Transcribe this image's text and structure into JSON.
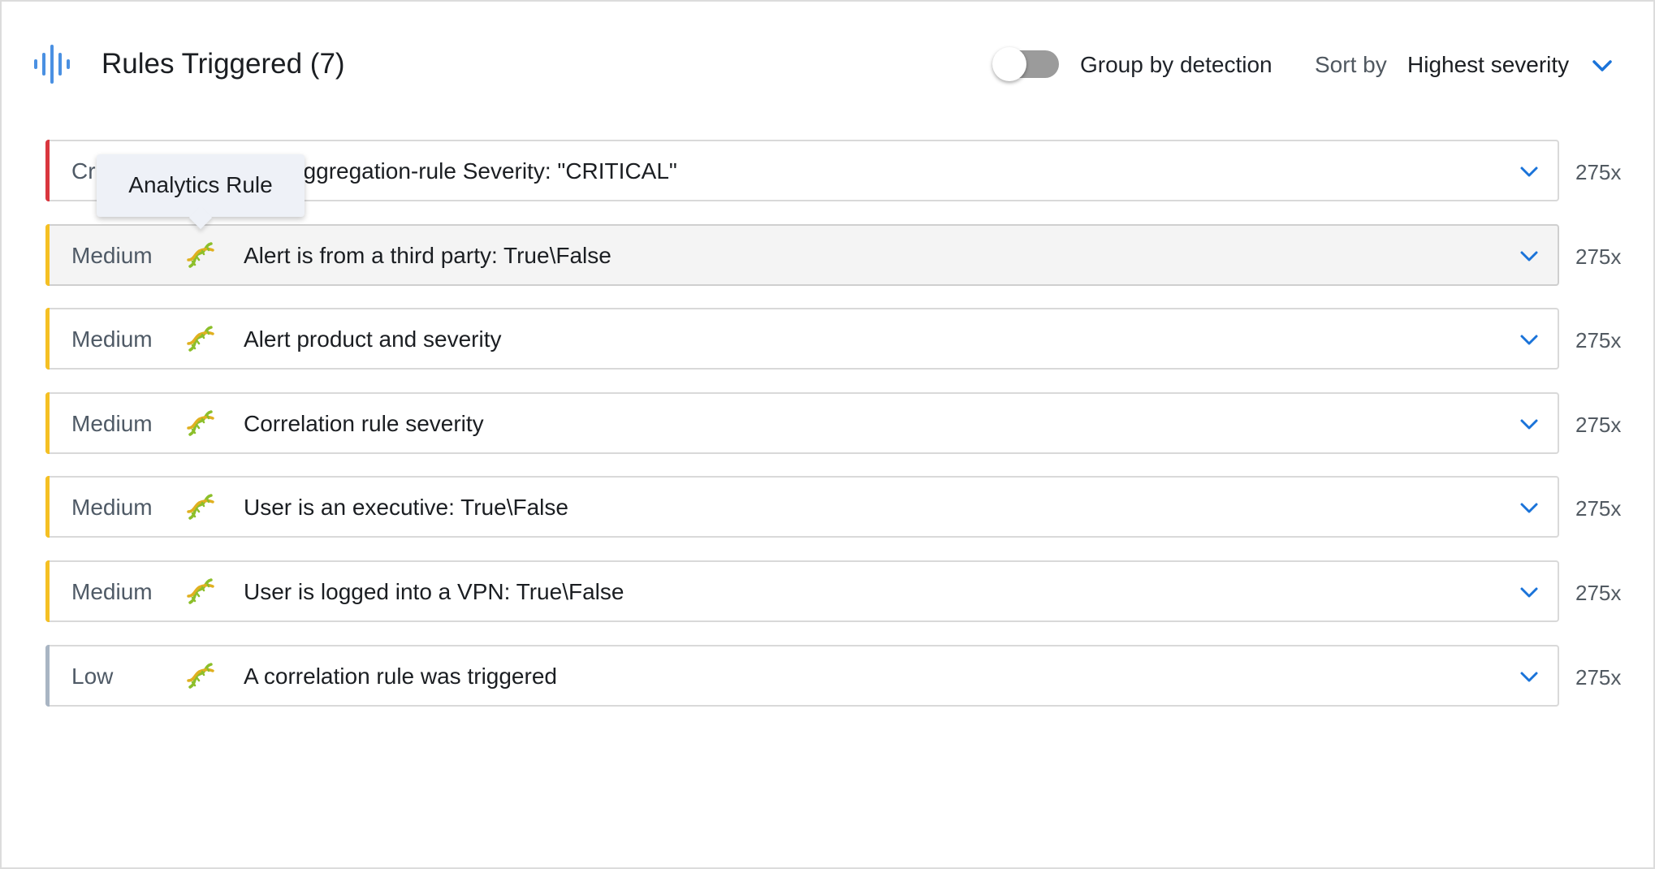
{
  "header": {
    "icon": "waveform-icon",
    "title": "Rules Triggered (7)",
    "group_by_label": "Group by detection",
    "group_by_enabled": false,
    "sort_label": "Sort by",
    "sort_value": "Highest severity"
  },
  "tooltip": {
    "text": "Analytics Rule"
  },
  "colors": {
    "critical": "#d9363e",
    "medium": "#f5c023",
    "low": "#a9b5c3",
    "accent_blue": "#1a73d9",
    "icon_blue": "#4a90e2"
  },
  "rules": [
    {
      "severity": "Critical",
      "severity_visible": "Cr",
      "icon": "dna-icon",
      "name": "aggregation-rule Severity: \"CRITICAL\"",
      "count": "275x"
    },
    {
      "severity": "Medium",
      "icon": "dna-icon",
      "name": "Alert is from a third party: True\\False",
      "count": "275x"
    },
    {
      "severity": "Medium",
      "icon": "dna-icon",
      "name": "Alert product and severity",
      "count": "275x"
    },
    {
      "severity": "Medium",
      "icon": "dna-icon",
      "name": "Correlation rule severity",
      "count": "275x"
    },
    {
      "severity": "Medium",
      "icon": "dna-icon",
      "name": "User is an executive: True\\False",
      "count": "275x"
    },
    {
      "severity": "Medium",
      "icon": "dna-icon",
      "name": "User is logged into a VPN: True\\False",
      "count": "275x"
    },
    {
      "severity": "Low",
      "icon": "dna-icon",
      "name": "A correlation rule was triggered",
      "count": "275x"
    }
  ]
}
